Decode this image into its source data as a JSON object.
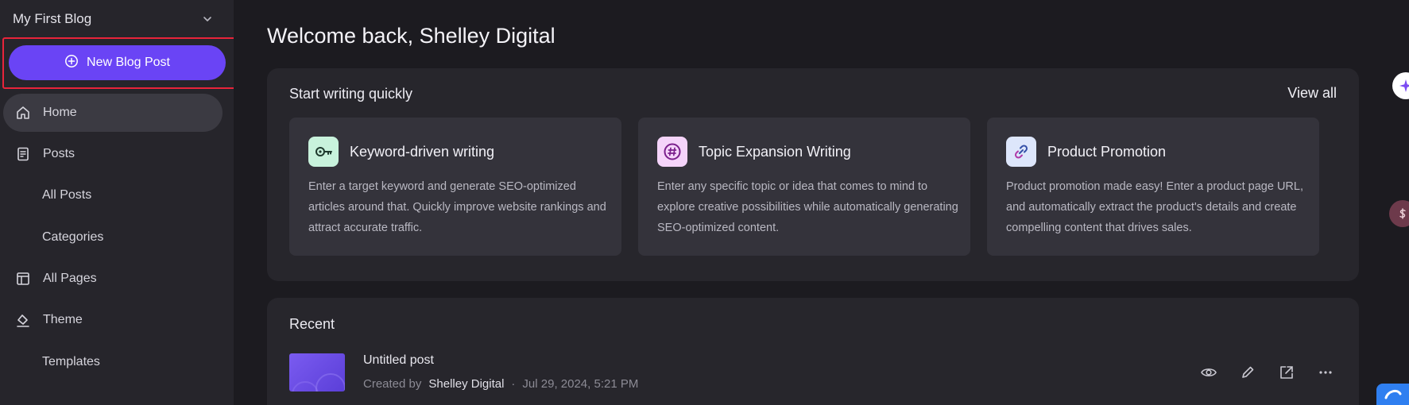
{
  "sidebar": {
    "blog_name": "My First Blog",
    "new_post_label": "New Blog Post",
    "nav": {
      "home": "Home",
      "posts": "Posts",
      "all_posts": "All Posts",
      "categories": "Categories",
      "all_pages": "All Pages",
      "theme": "Theme",
      "templates": "Templates"
    }
  },
  "main": {
    "welcome": "Welcome back, Shelley Digital",
    "quick": {
      "heading": "Start writing quickly",
      "view_all": "View all",
      "cards": [
        {
          "title": "Keyword-driven writing",
          "desc": "Enter a target keyword and generate SEO-optimized articles around that. Quickly improve website rankings and attract accurate traffic.",
          "icon": "key-icon",
          "icon_bg": "#c8f2dc"
        },
        {
          "title": "Topic Expansion Writing",
          "desc": "Enter any specific topic or idea that comes to mind to explore creative possibilities while automatically generating SEO-optimized content.",
          "icon": "hashtag-icon",
          "icon_bg": "#f5d4fa"
        },
        {
          "title": "Product Promotion",
          "desc": "Product promotion made easy! Enter a product page URL, and automatically extract the product's details and create compelling content that drives sales.",
          "icon": "link-icon",
          "icon_bg": "#dde6fb"
        }
      ]
    },
    "recent": {
      "heading": "Recent",
      "items": [
        {
          "title": "Untitled post",
          "created_by_label": "Created by",
          "author": "Shelley Digital",
          "separator": "·",
          "date": "Jul 29, 2024, 5:21 PM"
        }
      ]
    }
  },
  "colors": {
    "accent": "#6a44f5",
    "highlight_border": "#e8243a"
  }
}
